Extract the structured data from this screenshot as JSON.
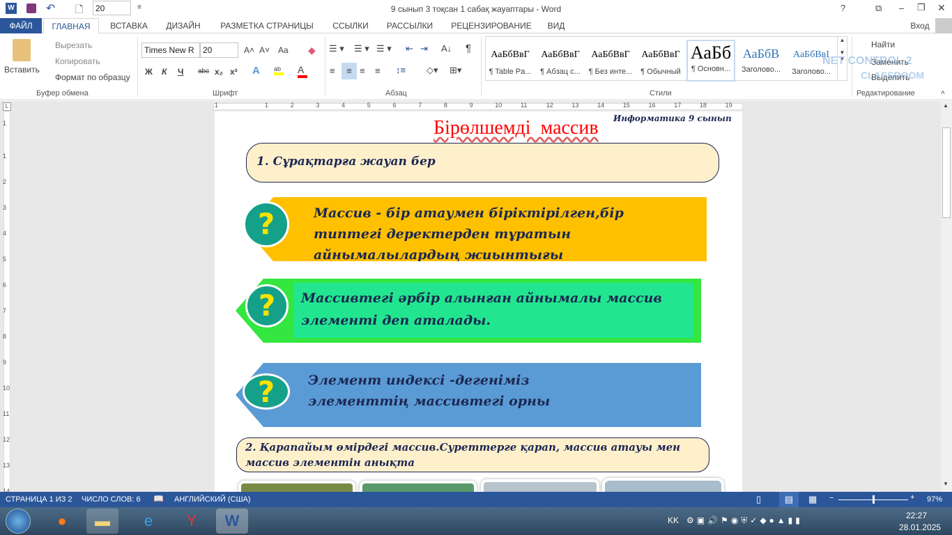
{
  "window": {
    "title": "9 сынып 3 тоқсан 1 сабақ жауаптары - Word",
    "font_size_quick": "20",
    "controls": [
      "?",
      "⧉",
      "–",
      "❐",
      "✕"
    ]
  },
  "tabs": [
    "ФАЙЛ",
    "ГЛАВНАЯ",
    "ВСТАВКА",
    "ДИЗАЙН",
    "РАЗМЕТКА СТРАНИЦЫ",
    "ССЫЛКИ",
    "РАССЫЛКИ",
    "РЕЦЕНЗИРОВАНИЕ",
    "ВИД"
  ],
  "active_tab": "ГЛАВНАЯ",
  "signin": "Вход",
  "ribbon": {
    "clipboard": {
      "paste": "Вставить",
      "cut": "Вырезать",
      "copy": "Копировать",
      "format_painter": "Формат по образцу",
      "label": "Буфер обмена"
    },
    "font": {
      "name": "Times New R",
      "size": "20",
      "bold": "Ж",
      "italic": "К",
      "underline": "Ч",
      "strike": "abc",
      "sub": "x₂",
      "sup": "x²",
      "grow": "A˄",
      "shrink": "A˅",
      "case": "Aa",
      "label": "Шрифт",
      "highlight_color": "#ffff00",
      "font_color": "#ff0000"
    },
    "paragraph": {
      "label": "Абзац",
      "pilcrow": "¶"
    },
    "styles": {
      "label": "Стили",
      "items": [
        {
          "preview": "АаБбВвГ",
          "name": "¶ Table Pa..."
        },
        {
          "preview": "АаБбВвГ",
          "name": "¶ Абзац с..."
        },
        {
          "preview": "АаБбВвГ",
          "name": "¶ Без инте..."
        },
        {
          "preview": "АаБбВвГ",
          "name": "¶ Обычный"
        },
        {
          "preview": "АаБб",
          "name": "¶ Основн..."
        },
        {
          "preview": "АаБбВ",
          "name": "Заголово..."
        },
        {
          "preview": "АаБбВвІ",
          "name": "Заголово..."
        }
      ]
    },
    "editing": {
      "find": "Найти",
      "replace": "Заменить",
      "select": "Выделить",
      "label": "Редактирование"
    },
    "watermark": "NET CONTROL 2 CLASSROOM"
  },
  "ruler": {
    "h": [
      "1",
      "1",
      "2",
      "3",
      "4",
      "5",
      "6",
      "7",
      "8",
      "9",
      "10",
      "11",
      "12",
      "13",
      "14",
      "15",
      "16",
      "17",
      "18",
      "19"
    ],
    "v": [
      "1",
      "1",
      "2",
      "3",
      "4",
      "5",
      "6",
      "7",
      "8",
      "9",
      "10",
      "11",
      "12",
      "13",
      "14"
    ]
  },
  "document": {
    "header_note": "Информатика 9 сынып",
    "title": "Бірөлшемді  массив",
    "task1": "1. Сұрақтарға жауап бер",
    "cards": [
      {
        "text": "Массив - бір атаумен біріктірілген,бір типтегі деректерден тұратын айнымалылардың жиынтығы",
        "color": "#ffc000"
      },
      {
        "text": "Массивтегі әрбір алынған айнымалы массив элементі деп аталады.",
        "color": "#22e68f",
        "edge": "#33e640"
      },
      {
        "text": "Элемент индексі -дегеніміз элементтің массивтегі орны",
        "color": "#5b9bd5"
      }
    ],
    "question_mark": "?",
    "task2": "2. Қарапайым өмірдегі массив.Суреттерге қарап, массив атауы мен массив элементін анықта"
  },
  "status": {
    "page": "СТРАНИЦА 1 ИЗ 2",
    "words": "ЧИСЛО СЛОВ: 6",
    "language": "АНГЛИЙСКИЙ (США)",
    "zoom": "97%",
    "zoom_percent": 97
  },
  "taskbar": {
    "lang": "KK",
    "time": "22:27",
    "date": "28.01.2025"
  },
  "colors": {
    "accent": "#2b579a"
  }
}
